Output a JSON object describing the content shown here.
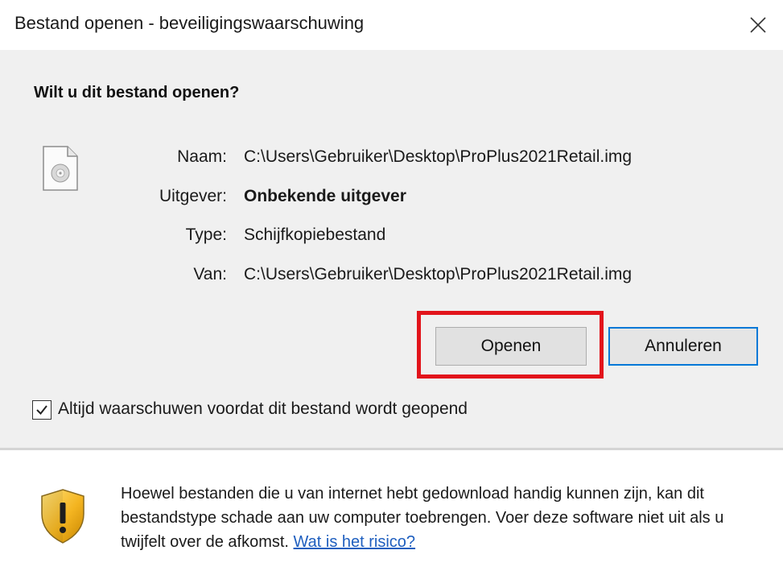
{
  "window": {
    "title": "Bestand openen - beveiligingswaarschuwing"
  },
  "dialog": {
    "heading": "Wilt u dit bestand openen?",
    "fields": [
      {
        "label": "Naam:",
        "value": "C:\\Users\\Gebruiker\\Desktop\\ProPlus2021Retail.img"
      },
      {
        "label": "Uitgever:",
        "value": "Onbekende uitgever"
      },
      {
        "label": "Type:",
        "value": "Schijfkopiebestand"
      },
      {
        "label": "Van:",
        "value": "C:\\Users\\Gebruiker\\Desktop\\ProPlus2021Retail.img"
      }
    ],
    "buttons": {
      "open_label": "Openen",
      "cancel_label": "Annuleren"
    },
    "checkbox": {
      "label": "Altijd waarschuwen voordat dit bestand wordt geopend",
      "checked": true
    },
    "warning": {
      "text": "Hoewel bestanden die u van internet hebt gedownload handig kunnen zijn, kan dit bestandstype schade aan uw computer toebrengen. Voer deze software niet uit als u twijfelt over de afkomst.",
      "link_label": "Wat is het risico?"
    }
  },
  "icons": {
    "file": "disc-image-file-icon",
    "shield": "warning-shield-icon",
    "close": "close-icon",
    "check": "checkmark-icon"
  },
  "colors": {
    "highlight": "#e2141b",
    "focus_border": "#0078d7",
    "link": "#1f5fbf",
    "panel": "#f0f0f0"
  }
}
